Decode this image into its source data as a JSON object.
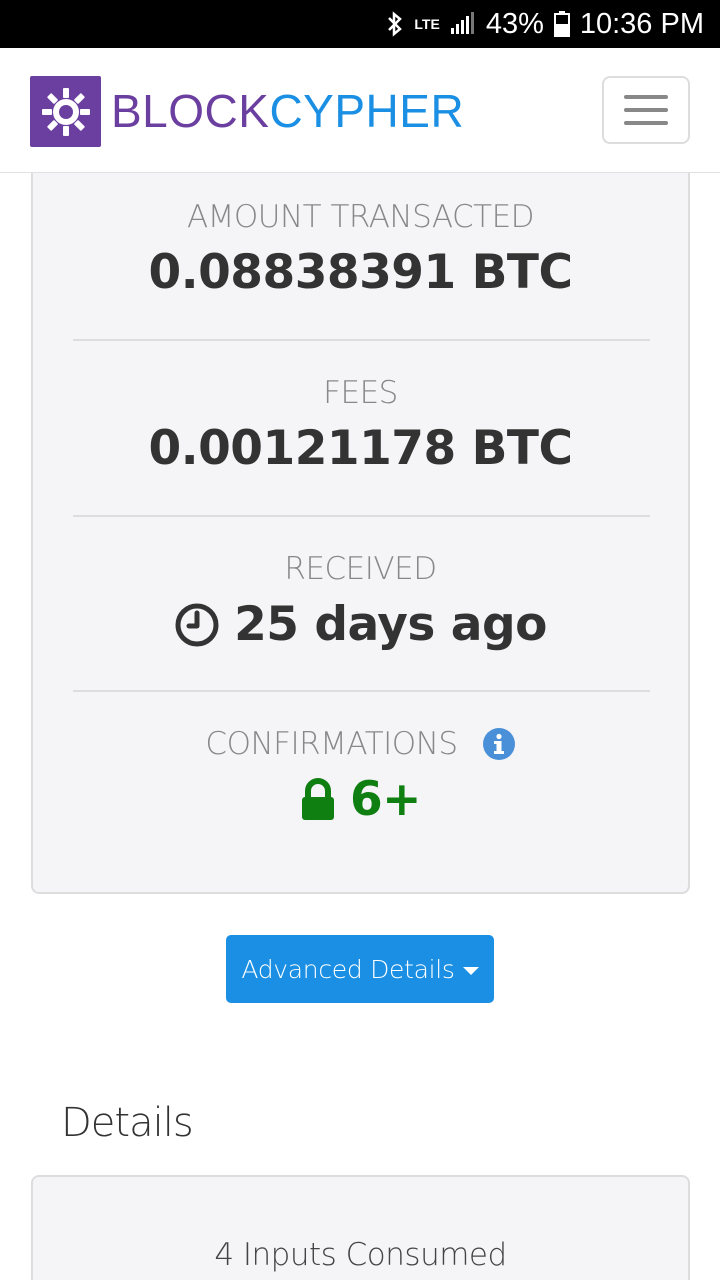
{
  "status_bar": {
    "network": "LTE",
    "battery": "43%",
    "time": "10:36 PM"
  },
  "navbar": {
    "brand_part1": "BLOCK",
    "brand_part2": "CYPHER",
    "brand_colors": {
      "block": "#6b3fa0",
      "cypher": "#1a8fe3"
    }
  },
  "summary": {
    "amount_label": "AMOUNT TRANSACTED",
    "amount_value": "0.08838391 BTC",
    "fees_label": "FEES",
    "fees_value": "0.00121178 BTC",
    "received_label": "RECEIVED",
    "received_value": "25 days ago",
    "confirmations_label": "CONFIRMATIONS",
    "confirmations_value": "6+",
    "confirmations_color": "#0f7f12"
  },
  "advanced_button": {
    "label": "Advanced Details"
  },
  "details": {
    "heading": "Details",
    "inputs_label": "4 Inputs Consumed"
  },
  "icons": [
    "bluetooth-icon",
    "signal-icon",
    "battery-icon",
    "clock-icon",
    "info-icon",
    "lock-icon",
    "hamburger-icon",
    "caret-down-icon"
  ]
}
